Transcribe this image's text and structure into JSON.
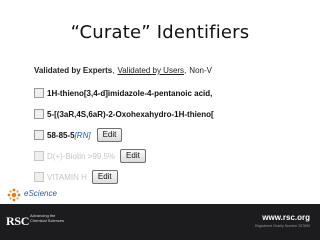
{
  "slide": {
    "title": "“Curate” Identifiers"
  },
  "tabs": {
    "active": "Validated by Experts",
    "separator": ",",
    "link": "Validated by Users",
    "separator2": ",",
    "partial": "Non-V"
  },
  "rows": [
    {
      "name": "1H-thieno[3,4-d]imidazole-4-pentanoic acid,"
    },
    {
      "name": "5-[(3aR,4S,6aR)-2-Oxohexahydro-1H-thieno["
    },
    {
      "rn_number": "58-85-5",
      "rn_tag": "[RN]",
      "edit": "Edit"
    },
    {
      "name": "D(+)-Biotin >99.5%",
      "edit": "Edit"
    },
    {
      "name": "VITAMIN H",
      "edit": "Edit"
    }
  ],
  "footer": {
    "logo_text": "eScience",
    "rsc": "RSC",
    "rsc_line1": "Advancing the",
    "rsc_line2": "Chemical Sciences",
    "url": "www.rsc.org",
    "tagline": "Registered Charity Number 207890"
  },
  "colors": {
    "footer_bg": "#1c1c1e",
    "link_blue": "#1a5aa5",
    "accent_orange": "#e07a1f"
  }
}
